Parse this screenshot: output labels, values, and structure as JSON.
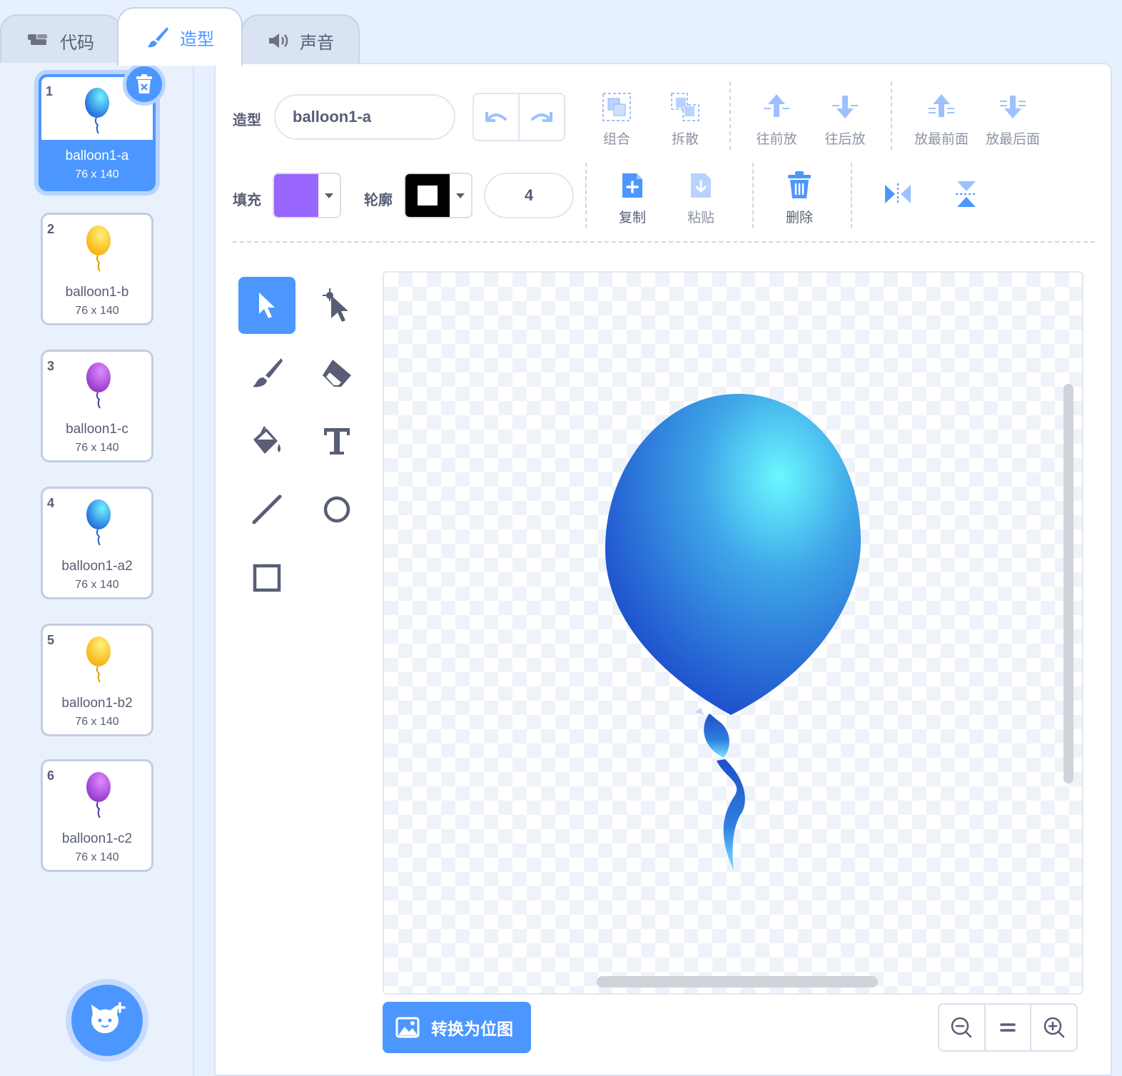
{
  "tabs": [
    {
      "label": "代码",
      "icon": "code-icon"
    },
    {
      "label": "造型",
      "icon": "brush-icon"
    },
    {
      "label": "声音",
      "icon": "speaker-icon"
    }
  ],
  "costumes": [
    {
      "num": "1",
      "name": "balloon1-a",
      "size": "76 x 140",
      "color": "#2f8fe8"
    },
    {
      "num": "2",
      "name": "balloon1-b",
      "size": "76 x 140",
      "color": "#ffc61a"
    },
    {
      "num": "3",
      "name": "balloon1-c",
      "size": "76 x 140",
      "color": "#a340d6"
    },
    {
      "num": "4",
      "name": "balloon1-a2",
      "size": "76 x 140",
      "color": "#2f8fe8"
    },
    {
      "num": "5",
      "name": "balloon1-b2",
      "size": "76 x 140",
      "color": "#ffc61a"
    },
    {
      "num": "6",
      "name": "balloon1-c2",
      "size": "76 x 140",
      "color": "#a340d6"
    }
  ],
  "editor": {
    "costume_label": "造型",
    "costume_name": "balloon1-a",
    "fill_label": "填充",
    "fill_color": "#9966ff",
    "outline_label": "轮廓",
    "outline_color": "#000000",
    "outline_width": "4",
    "group": "组合",
    "ungroup": "拆散",
    "forward": "往前放",
    "backward": "往后放",
    "front": "放最前面",
    "back": "放最后面",
    "copy": "复制",
    "paste": "粘贴",
    "delete": "删除",
    "convert_bitmap": "转换为位图",
    "accent": "#4c97ff"
  }
}
